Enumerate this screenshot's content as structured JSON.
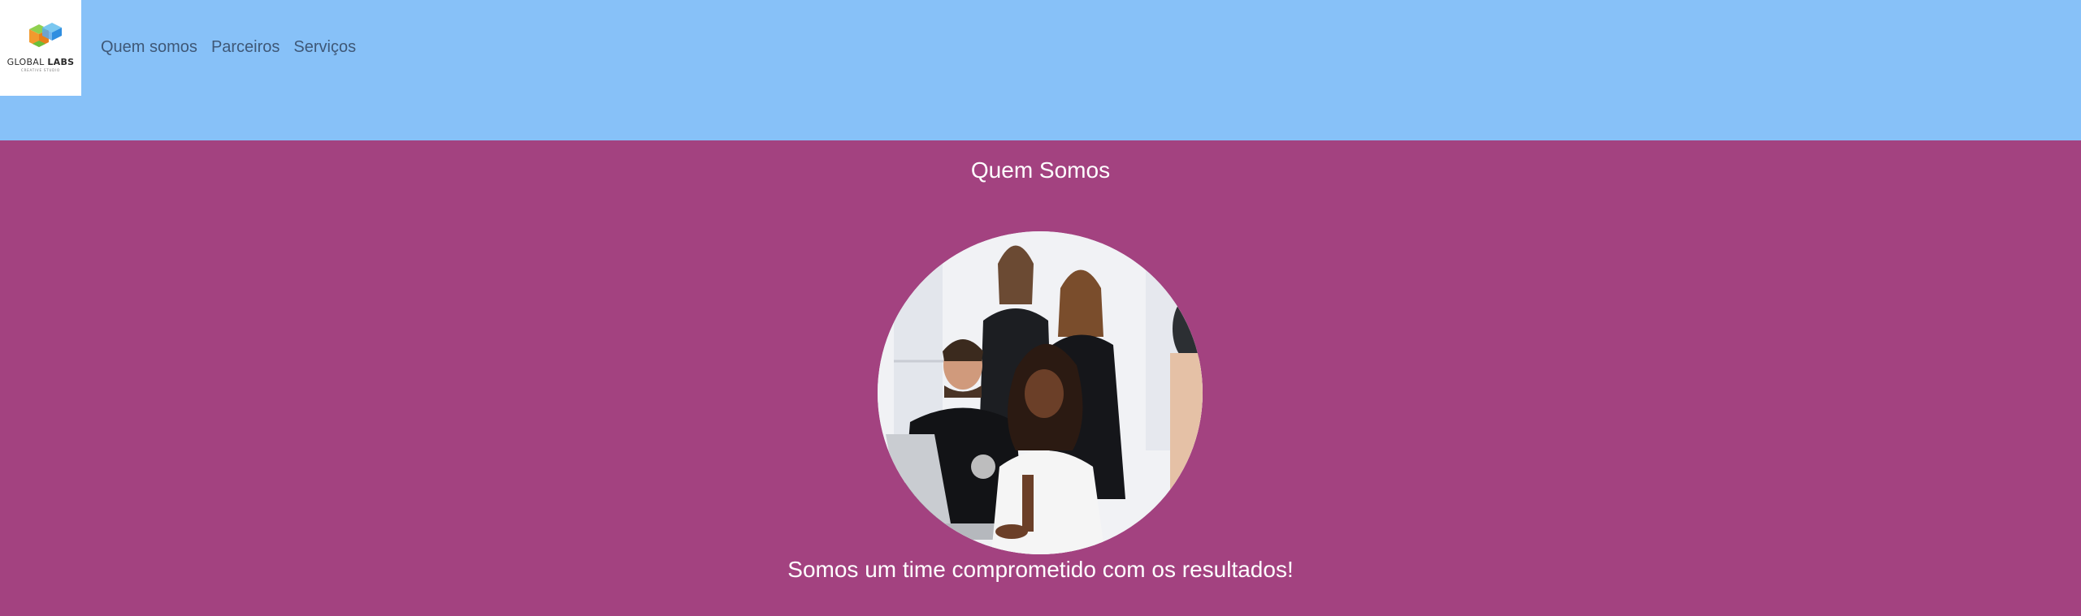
{
  "logo": {
    "brand_light": "GLOBAL ",
    "brand_bold": "LABS",
    "tagline": "creative studio",
    "colors": {
      "orange": "#f29a2e",
      "green": "#6bbf3a",
      "blue": "#2f8ee0"
    }
  },
  "nav": {
    "items": [
      {
        "label": "Quem somos"
      },
      {
        "label": "Parceiros"
      },
      {
        "label": "Serviços"
      }
    ]
  },
  "about": {
    "title": "Quem Somos",
    "photo_icon": "team-photo",
    "tagline": "Somos um time comprometido com os resultados!"
  },
  "colors": {
    "header_bg": "#87c1f8",
    "section_bg": "#a34280",
    "nav_text": "#3f5877",
    "title_text": "#ffffff"
  }
}
